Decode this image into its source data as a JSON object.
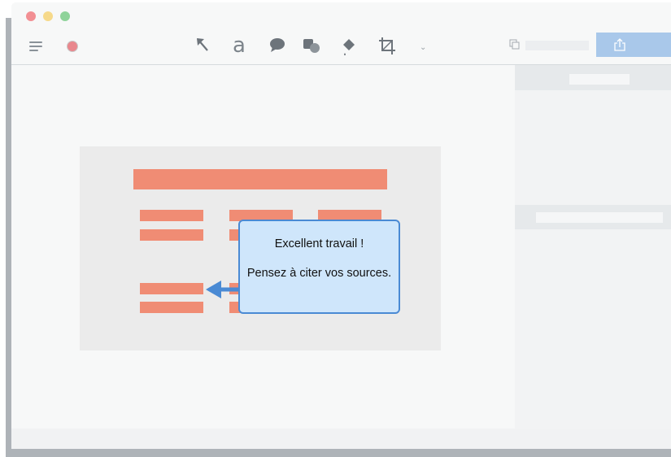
{
  "window": {
    "traffic_lights": [
      "close",
      "minimize",
      "zoom"
    ]
  },
  "toolbar": {
    "text_tool_glyph": "a",
    "more_glyph": "⌄",
    "tools": [
      "arrow-tool",
      "text-tool",
      "speech-bubble-tool",
      "shapes-tool",
      "fill-tool",
      "crop-tool"
    ],
    "share_field_value": ""
  },
  "callout": {
    "line1": "Excellent travail !",
    "line2": "Pensez à citer vos sources."
  },
  "colors": {
    "accent": "#4a8ad4",
    "callout_fill": "#cfe6fb",
    "placeholder_bar": "#f08c74",
    "record": "#e9878d",
    "share": "#a9c8ea"
  }
}
